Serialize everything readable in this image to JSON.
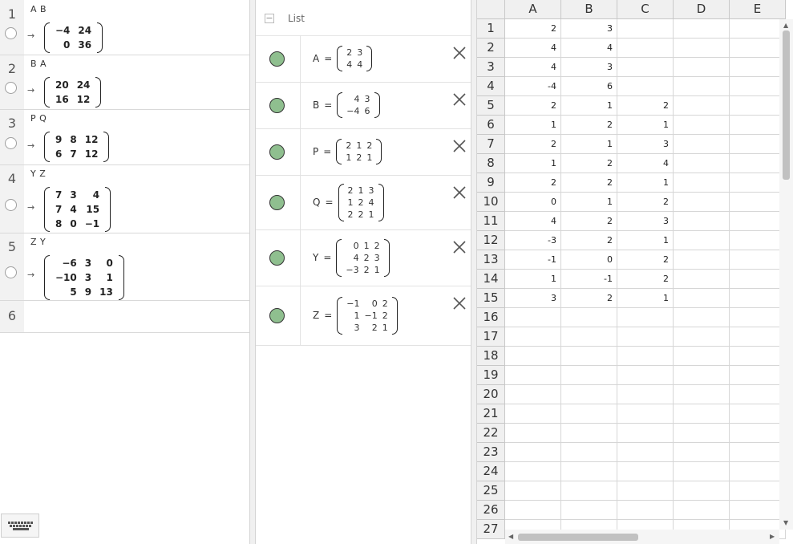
{
  "cas": {
    "rows": [
      {
        "num": "1",
        "input": "A B",
        "output": [
          [
            "−4",
            "24"
          ],
          [
            "0",
            "36"
          ]
        ]
      },
      {
        "num": "2",
        "input": "B A",
        "output": [
          [
            "20",
            "24"
          ],
          [
            "16",
            "12"
          ]
        ]
      },
      {
        "num": "3",
        "input": "P Q",
        "output": [
          [
            "9",
            "8",
            "12"
          ],
          [
            "6",
            "7",
            "12"
          ]
        ]
      },
      {
        "num": "4",
        "input": "Y Z",
        "output": [
          [
            "7",
            "3",
            "4"
          ],
          [
            "7",
            "4",
            "15"
          ],
          [
            "8",
            "0",
            "−1"
          ]
        ]
      },
      {
        "num": "5",
        "input": "Z Y",
        "output": [
          [
            "−6",
            "3",
            "0"
          ],
          [
            "−10",
            "3",
            "1"
          ],
          [
            "5",
            "9",
            "13"
          ]
        ]
      },
      {
        "num": "6",
        "input": "",
        "output": null
      }
    ],
    "arrow": "→"
  },
  "algebra": {
    "title": "List",
    "collapse_symbol": "−",
    "items": [
      {
        "name": "A",
        "rows": [
          [
            "2",
            "3"
          ],
          [
            "4",
            "4"
          ]
        ]
      },
      {
        "name": "B",
        "rows": [
          [
            "4",
            "3"
          ],
          [
            "−4",
            "6"
          ]
        ]
      },
      {
        "name": "P",
        "rows": [
          [
            "2",
            "1",
            "2"
          ],
          [
            "1",
            "2",
            "1"
          ]
        ]
      },
      {
        "name": "Q",
        "rows": [
          [
            "2",
            "1",
            "3"
          ],
          [
            "1",
            "2",
            "4"
          ],
          [
            "2",
            "2",
            "1"
          ]
        ]
      },
      {
        "name": "Y",
        "rows": [
          [
            "0",
            "1",
            "2"
          ],
          [
            "4",
            "2",
            "3"
          ],
          [
            "−3",
            "2",
            "1"
          ]
        ]
      },
      {
        "name": "Z",
        "rows": [
          [
            "−1",
            "0",
            "2"
          ],
          [
            "1",
            "−1",
            "2"
          ],
          [
            "3",
            "2",
            "1"
          ]
        ]
      }
    ],
    "marble_color": "#8fbf8f"
  },
  "spreadsheet": {
    "columns": [
      "A",
      "B",
      "C",
      "D",
      "E"
    ],
    "row_labels": [
      "1",
      "2",
      "3",
      "4",
      "5",
      "6",
      "7",
      "8",
      "9",
      "10",
      "11",
      "12",
      "13",
      "14",
      "15",
      "16",
      "17",
      "18",
      "19",
      "20",
      "21",
      "22",
      "23",
      "24",
      "25",
      "26",
      "27"
    ],
    "cells": [
      [
        "2",
        "3",
        ""
      ],
      [
        "4",
        "4",
        ""
      ],
      [
        "4",
        "3",
        ""
      ],
      [
        "-4",
        "6",
        ""
      ],
      [
        "2",
        "1",
        "2"
      ],
      [
        "1",
        "2",
        "1"
      ],
      [
        "2",
        "1",
        "3"
      ],
      [
        "1",
        "2",
        "4"
      ],
      [
        "2",
        "2",
        "1"
      ],
      [
        "0",
        "1",
        "2"
      ],
      [
        "4",
        "2",
        "3"
      ],
      [
        "-3",
        "2",
        "1"
      ],
      [
        "-1",
        "0",
        "2"
      ],
      [
        "1",
        "-1",
        "2"
      ],
      [
        "3",
        "2",
        "1"
      ]
    ]
  }
}
